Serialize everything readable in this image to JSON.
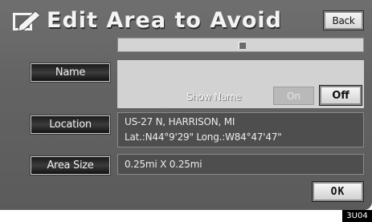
{
  "header": {
    "title": "Edit Area to Avoid",
    "icon": "pencil-edit-icon",
    "back_label": "Back"
  },
  "fields": {
    "name": {
      "label": "Name",
      "show_name_label": "Show Name",
      "on_label": "On",
      "off_label": "Off"
    },
    "location": {
      "label": "Location",
      "line1": "US-27 N, HARRISON, MI",
      "line2": "Lat.:N44°9'29\"  Long.:W84°47'47\""
    },
    "area_size": {
      "label": "Area Size",
      "value": "0.25mi X 0.25mi"
    }
  },
  "footer": {
    "ok_label": "OK",
    "figure_code": "3U04"
  },
  "colors": {
    "panel": "#636363",
    "name_box": "#d2d2d2",
    "side_button": "#1f1f1f",
    "white_button": "#f0f0f0"
  }
}
